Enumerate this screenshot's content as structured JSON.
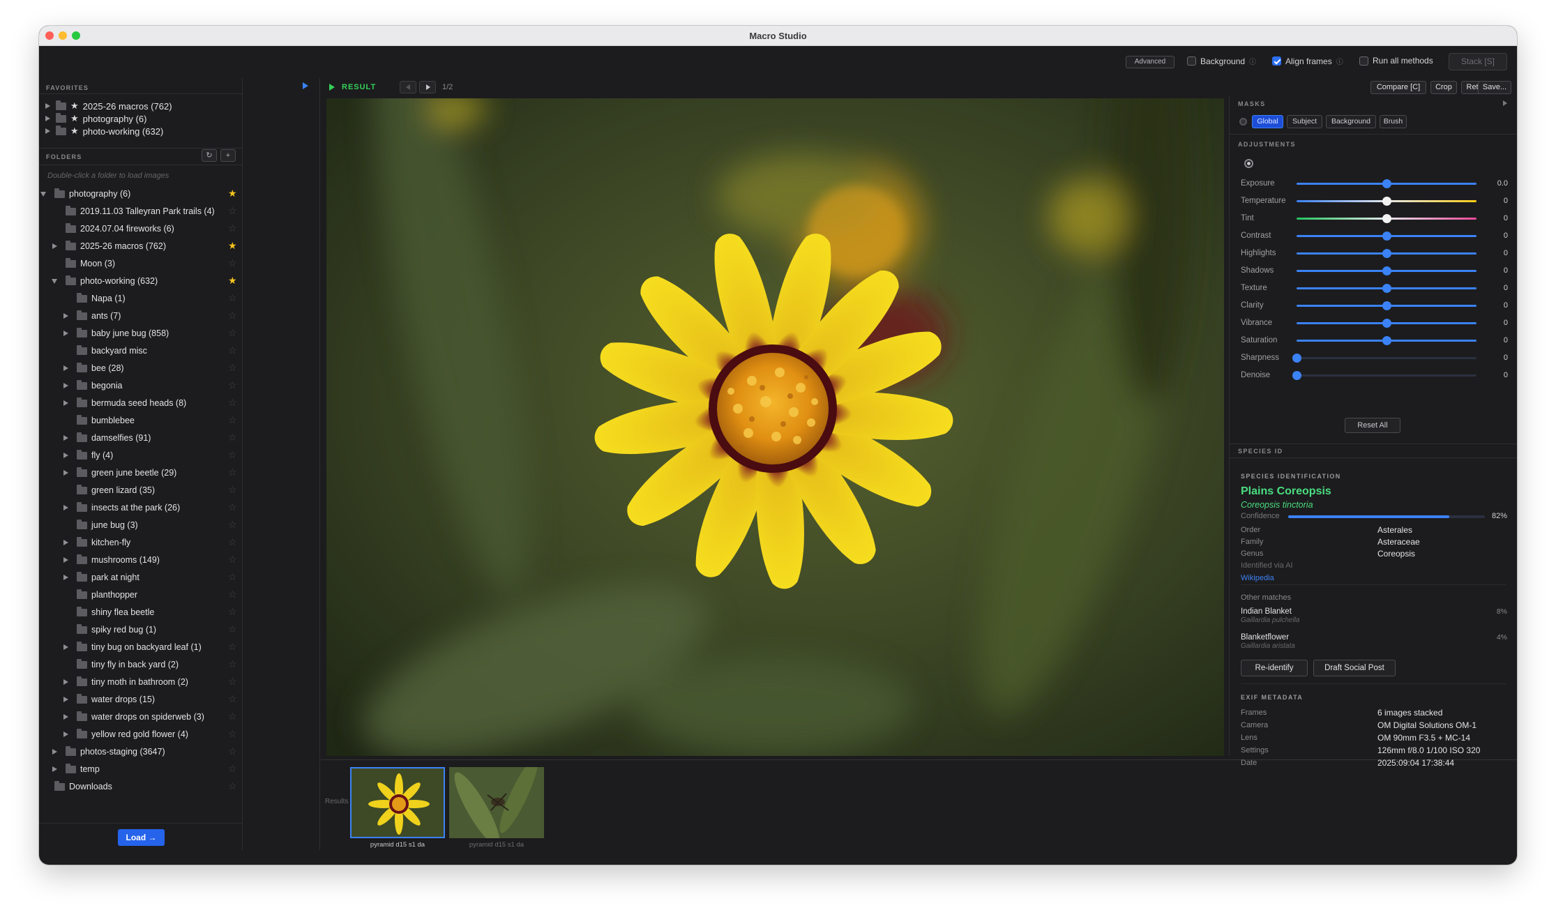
{
  "window": {
    "title": "Macro Studio"
  },
  "toolbar": {
    "advanced_label": "Advanced",
    "background_label": "Background",
    "background_checked": false,
    "align_frames_label": "Align frames",
    "align_frames_checked": true,
    "run_all_label": "Run all methods",
    "run_all_checked": false,
    "stack_label": "Stack [S]",
    "info_glyph": "ⓘ"
  },
  "sidebar": {
    "favorites_header": "FAVORITES",
    "favorites": [
      {
        "label": "2025-26 macros  (762)"
      },
      {
        "label": "photography  (6)"
      },
      {
        "label": "photo-working  (632)"
      }
    ],
    "folders_header": "FOLDERS",
    "refresh_glyph": "↻",
    "add_glyph": "+",
    "hint": "Double-click a folder to load images",
    "tree": [
      {
        "label": "photography  (6)",
        "depth": 0,
        "arrow": "down",
        "star": true
      },
      {
        "label": "2019.11.03 Talleyran Park trails  (4)",
        "depth": 1,
        "arrow": "none",
        "star": false
      },
      {
        "label": "2024.07.04 fireworks  (6)",
        "depth": 1,
        "arrow": "none",
        "star": false
      },
      {
        "label": "2025-26 macros  (762)",
        "depth": 1,
        "arrow": "right",
        "star": true
      },
      {
        "label": "Moon  (3)",
        "depth": 1,
        "arrow": "none",
        "star": false
      },
      {
        "label": "photo-working  (632)",
        "depth": 1,
        "arrow": "down",
        "star": true
      },
      {
        "label": "Napa  (1)",
        "depth": 2,
        "arrow": "none",
        "star": false
      },
      {
        "label": "ants  (7)",
        "depth": 2,
        "arrow": "right",
        "star": false
      },
      {
        "label": "baby june bug  (858)",
        "depth": 2,
        "arrow": "right",
        "star": false
      },
      {
        "label": "backyard misc",
        "depth": 2,
        "arrow": "none",
        "star": false
      },
      {
        "label": "bee  (28)",
        "depth": 2,
        "arrow": "right",
        "star": false
      },
      {
        "label": "begonia",
        "depth": 2,
        "arrow": "right",
        "star": false
      },
      {
        "label": "bermuda seed heads  (8)",
        "depth": 2,
        "arrow": "right",
        "star": false
      },
      {
        "label": "bumblebee",
        "depth": 2,
        "arrow": "none",
        "star": false
      },
      {
        "label": "damselfies  (91)",
        "depth": 2,
        "arrow": "right",
        "star": false
      },
      {
        "label": "fly  (4)",
        "depth": 2,
        "arrow": "right",
        "star": false
      },
      {
        "label": "green june beetle  (29)",
        "depth": 2,
        "arrow": "right",
        "star": false
      },
      {
        "label": "green lizard  (35)",
        "depth": 2,
        "arrow": "none",
        "star": false
      },
      {
        "label": "insects at the park  (26)",
        "depth": 2,
        "arrow": "right",
        "star": false
      },
      {
        "label": "june bug  (3)",
        "depth": 2,
        "arrow": "none",
        "star": false
      },
      {
        "label": "kitchen-fly",
        "depth": 2,
        "arrow": "right",
        "star": false
      },
      {
        "label": "mushrooms  (149)",
        "depth": 2,
        "arrow": "right",
        "star": false
      },
      {
        "label": "park at night",
        "depth": 2,
        "arrow": "right",
        "star": false
      },
      {
        "label": "planthopper",
        "depth": 2,
        "arrow": "none",
        "star": false
      },
      {
        "label": "shiny flea beetle",
        "depth": 2,
        "arrow": "none",
        "star": false
      },
      {
        "label": "spiky red bug  (1)",
        "depth": 2,
        "arrow": "none",
        "star": false
      },
      {
        "label": "tiny bug on backyard leaf  (1)",
        "depth": 2,
        "arrow": "right",
        "star": false
      },
      {
        "label": "tiny fly in back yard  (2)",
        "depth": 2,
        "arrow": "none",
        "star": false
      },
      {
        "label": "tiny moth in bathroom  (2)",
        "depth": 2,
        "arrow": "right",
        "star": false
      },
      {
        "label": "water drops  (15)",
        "depth": 2,
        "arrow": "right",
        "star": false
      },
      {
        "label": "water drops on spiderweb  (3)",
        "depth": 2,
        "arrow": "right",
        "star": false
      },
      {
        "label": "yellow red gold flower  (4)",
        "depth": 2,
        "arrow": "right",
        "star": false
      },
      {
        "label": "photos-staging  (3647)",
        "depth": 1,
        "arrow": "right",
        "star": false
      },
      {
        "label": "temp",
        "depth": 1,
        "arrow": "right",
        "star": false
      },
      {
        "label": "Downloads",
        "depth": 0,
        "arrow": "none",
        "star": false
      }
    ],
    "load_label": "Load →"
  },
  "viewer": {
    "result_label": "RESULT",
    "counter": "1/2",
    "compare_label": "Compare  [C]",
    "crop_label": "Crop",
    "retouch_label": "Retouch",
    "save_label": "Save..."
  },
  "filmstrip": {
    "label": "Results",
    "thumbs": [
      {
        "caption": "pyramid d15 s1 da",
        "selected": true
      },
      {
        "caption": "pyramid d15 s1 da",
        "selected": false
      }
    ]
  },
  "masks": {
    "header": "MASKS",
    "buttons": [
      "Global",
      "Subject",
      "Background",
      "Brush"
    ],
    "active": "Global"
  },
  "adjustments": {
    "header": "ADJUSTMENTS",
    "sliders": [
      {
        "label": "Exposure",
        "value": "0.0",
        "pos": 0.5,
        "knob": "blue",
        "track": "blue"
      },
      {
        "label": "Temperature",
        "value": "0",
        "pos": 0.5,
        "knob": "white",
        "track": "temp"
      },
      {
        "label": "Tint",
        "value": "0",
        "pos": 0.5,
        "knob": "white",
        "track": "tint"
      },
      {
        "label": "Contrast",
        "value": "0",
        "pos": 0.5,
        "knob": "blue",
        "track": "blue"
      },
      {
        "label": "Highlights",
        "value": "0",
        "pos": 0.5,
        "knob": "blue",
        "track": "blue"
      },
      {
        "label": "Shadows",
        "value": "0",
        "pos": 0.5,
        "knob": "blue",
        "track": "blue"
      },
      {
        "label": "Texture",
        "value": "0",
        "pos": 0.5,
        "knob": "blue",
        "track": "blue"
      },
      {
        "label": "Clarity",
        "value": "0",
        "pos": 0.5,
        "knob": "blue",
        "track": "blue"
      },
      {
        "label": "Vibrance",
        "value": "0",
        "pos": 0.5,
        "knob": "blue",
        "track": "blue"
      },
      {
        "label": "Saturation",
        "value": "0",
        "pos": 0.5,
        "knob": "blue",
        "track": "blue"
      },
      {
        "label": "Sharpness",
        "value": "0",
        "pos": 0.0,
        "knob": "blue",
        "track": "none"
      },
      {
        "label": "Denoise",
        "value": "0",
        "pos": 0.0,
        "knob": "blue",
        "track": "none"
      }
    ],
    "reset_label": "Reset All"
  },
  "species": {
    "header": "SPECIES ID",
    "section_title": "SPECIES IDENTIFICATION",
    "common_name": "Plains Coreopsis",
    "scientific_name": "Coreopsis tinctoria",
    "confidence_label": "Confidence",
    "confidence_value": "82%",
    "confidence_fraction": 0.82,
    "taxonomy": [
      {
        "key": "Order",
        "value": "Asterales"
      },
      {
        "key": "Family",
        "value": "Asteraceae"
      },
      {
        "key": "Genus",
        "value": "Coreopsis"
      }
    ],
    "identified_via": "Identified via AI",
    "wikipedia_link": "Wikipedia",
    "other_matches_label": "Other matches",
    "other_matches": [
      {
        "name": "Indian Blanket",
        "scientific": "Gaillardia pulchella",
        "pct": "8%"
      },
      {
        "name": "Blanketflower",
        "scientific": "Gaillardia aristata",
        "pct": "4%"
      }
    ],
    "reidentify_label": "Re-identify",
    "draft_post_label": "Draft Social Post"
  },
  "exif": {
    "header": "EXIF METADATA",
    "rows": [
      {
        "key": "Frames",
        "value": "6 images stacked"
      },
      {
        "key": "Camera",
        "value": "OM Digital Solutions OM-1"
      },
      {
        "key": "Lens",
        "value": "OM 90mm F3.5 + MC-14"
      },
      {
        "key": "Settings",
        "value": "126mm  f/8.0  1/100  ISO 320"
      },
      {
        "key": "Date",
        "value": "2025:09:04 17:38:44"
      }
    ]
  },
  "colors": {
    "accent": "#2563eb",
    "green": "#34d058",
    "star_on": "#f5c41d",
    "species_name": "#4ade80",
    "link": "#3b82f6"
  }
}
